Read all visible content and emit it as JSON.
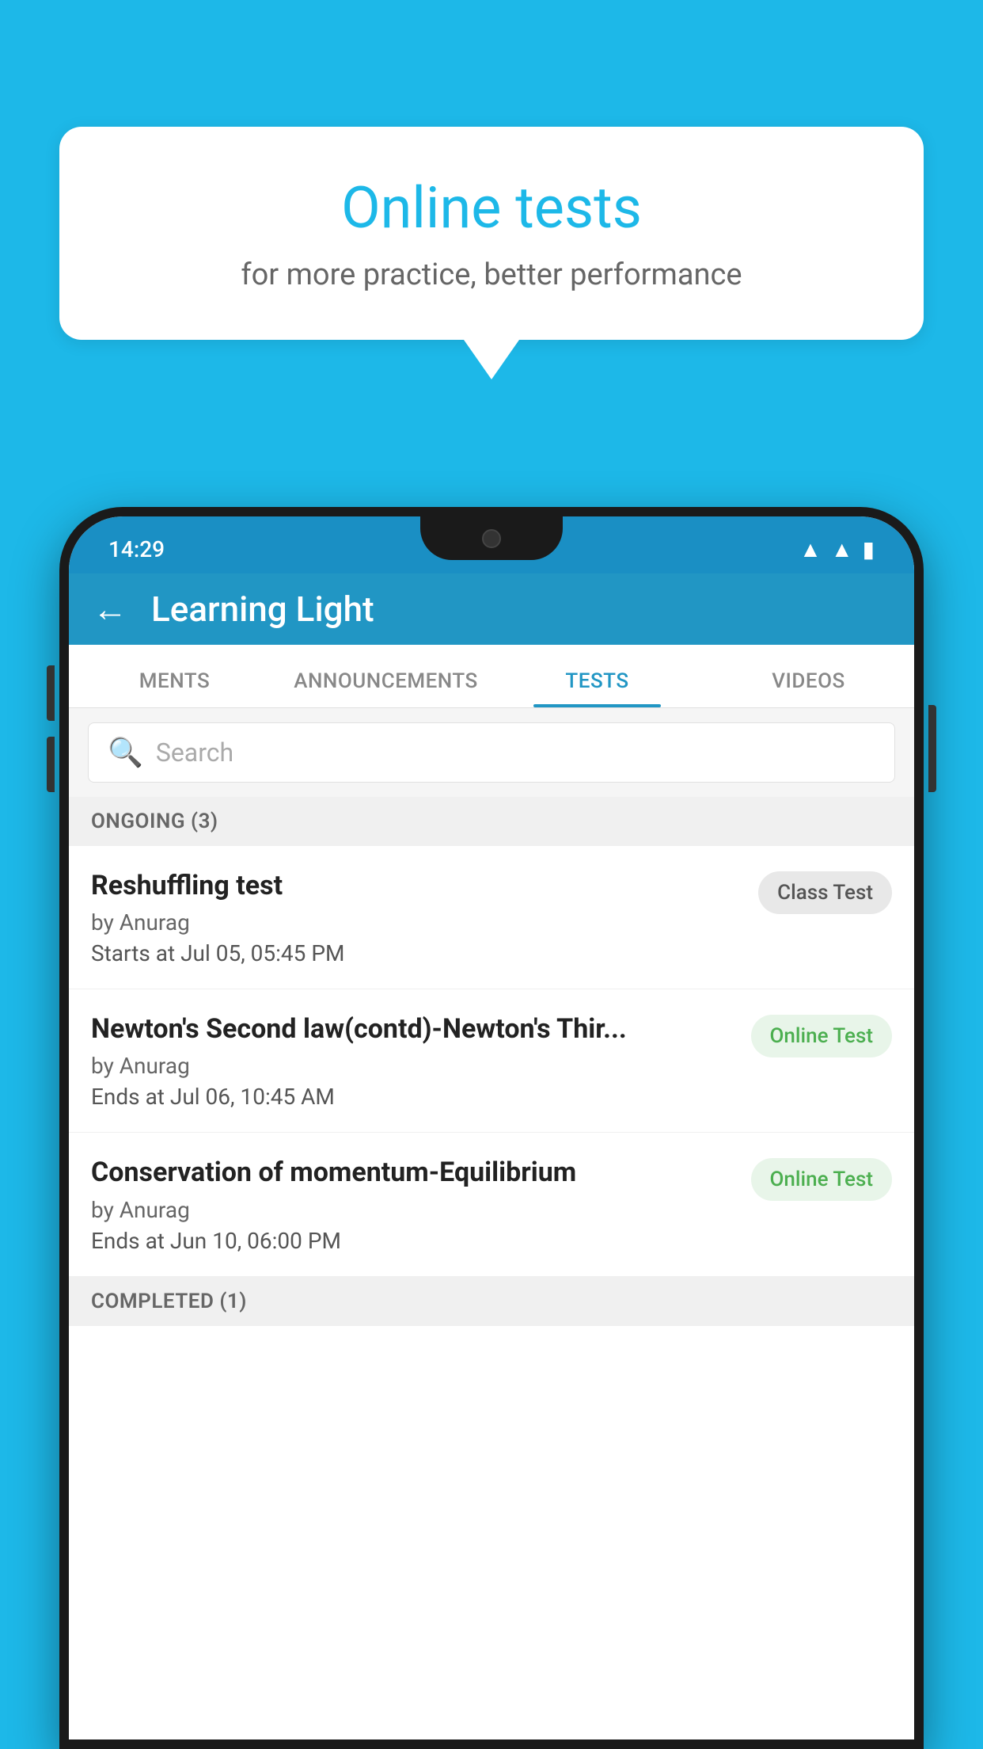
{
  "background_color": "#1db8e8",
  "speech_bubble": {
    "title": "Online tests",
    "subtitle": "for more practice, better performance"
  },
  "status_bar": {
    "time": "14:29",
    "icons": [
      "wifi",
      "signal",
      "battery"
    ]
  },
  "app_header": {
    "title": "Learning Light",
    "back_label": "←"
  },
  "tabs": [
    {
      "label": "MENTS",
      "active": false
    },
    {
      "label": "ANNOUNCEMENTS",
      "active": false
    },
    {
      "label": "TESTS",
      "active": true
    },
    {
      "label": "VIDEOS",
      "active": false
    }
  ],
  "search": {
    "placeholder": "Search"
  },
  "ongoing_section": {
    "label": "ONGOING (3)"
  },
  "tests": [
    {
      "name": "Reshuffling test",
      "by": "by Anurag",
      "time_label": "Starts at",
      "time": "Jul 05, 05:45 PM",
      "badge": "Class Test",
      "badge_type": "class"
    },
    {
      "name": "Newton's Second law(contd)-Newton's Thir...",
      "by": "by Anurag",
      "time_label": "Ends at",
      "time": "Jul 06, 10:45 AM",
      "badge": "Online Test",
      "badge_type": "online"
    },
    {
      "name": "Conservation of momentum-Equilibrium",
      "by": "by Anurag",
      "time_label": "Ends at",
      "time": "Jun 10, 06:00 PM",
      "badge": "Online Test",
      "badge_type": "online"
    }
  ],
  "completed_section": {
    "label": "COMPLETED (1)"
  }
}
